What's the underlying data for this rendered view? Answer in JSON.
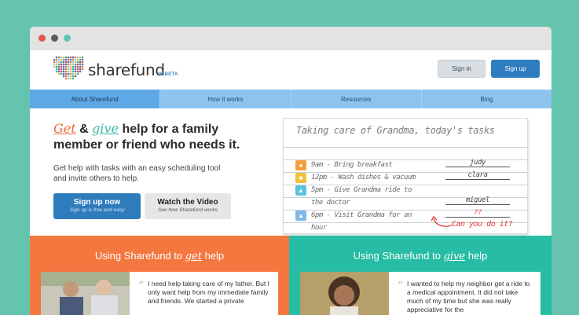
{
  "window": {
    "controls": [
      "close",
      "minimize",
      "maximize"
    ]
  },
  "header": {
    "brand": "sharefund",
    "beta": "IN BETA",
    "sign_in": "Sign in",
    "sign_up": "Sign up"
  },
  "nav": {
    "items": [
      {
        "label": "About Sharefund",
        "active": true
      },
      {
        "label": "How it works",
        "active": false
      },
      {
        "label": "Resources",
        "active": false
      },
      {
        "label": "Blog",
        "active": false
      }
    ]
  },
  "hero": {
    "title_get": "Get",
    "title_amp": " & ",
    "title_give": "give",
    "title_rest": " help for a family member or friend who needs it.",
    "description": "Get help with tasks with an easy scheduling tool and invite others to help.",
    "cta_primary_label": "Sign up now",
    "cta_primary_sub": "Sign up is free and easy",
    "cta_secondary_label": "Watch the Video",
    "cta_secondary_sub": "See how Sharefund works"
  },
  "task_note": {
    "title": "Taking care of Grandma, today's tasks",
    "tasks": [
      {
        "icon": "food-icon",
        "color": "#f3a03a",
        "time": "9am",
        "text": "9am - Bring breakfast",
        "assignee": "judy"
      },
      {
        "icon": "dishes-icon",
        "color": "#f0c13b",
        "time": "12pm",
        "text": "12pm - Wash dishes & vacuum",
        "assignee": "clara"
      },
      {
        "icon": "car-icon",
        "color": "#5bc4e0",
        "time": "5pm",
        "text": "5pm - Give Grandma ride to",
        "text2": "the doctor",
        "assignee": "miguel"
      },
      {
        "icon": "walk-icon",
        "color": "#7fb8e6",
        "time": "6pm",
        "text": "6pm - Visit Grandma for an",
        "text2": "hour",
        "assignee": "??"
      }
    ],
    "ask": "Can you do it?"
  },
  "panels": {
    "get": {
      "title_pre": "Using Sharefund to ",
      "title_hl": "get",
      "title_post": " help",
      "quote": "I need help taking care of my father.  But I only want help from my immediate family and friends. We started a private"
    },
    "give": {
      "title_pre": "Using Sharefund to ",
      "title_hl": "give",
      "title_post": " help",
      "quote": "I wanted to help my neighbor get a ride to a medical appointment. It did not take much of my time but she was really appreciative for the"
    }
  },
  "colors": {
    "background": "#65c4ae",
    "primary_blue": "#2f7cbd",
    "nav_blue": "#8cc3ef",
    "orange": "#f3773f",
    "teal": "#27bca4"
  }
}
